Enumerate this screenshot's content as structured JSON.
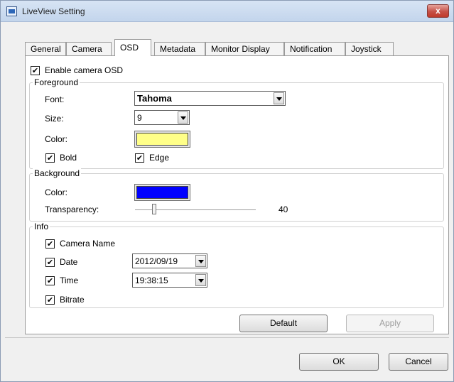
{
  "window": {
    "title": "LiveView Setting",
    "close_label": "x"
  },
  "tabs": [
    {
      "label": "General"
    },
    {
      "label": "Camera"
    },
    {
      "label": "OSD"
    },
    {
      "label": "Metadata"
    },
    {
      "label": "Monitor Display"
    },
    {
      "label": "Notification"
    },
    {
      "label": "Joystick"
    }
  ],
  "active_tab": "OSD",
  "osd": {
    "enable_label": "Enable camera OSD",
    "enable_checked": true,
    "foreground": {
      "title": "Foreground",
      "font_label": "Font:",
      "font_value": "Tahoma",
      "size_label": "Size:",
      "size_value": "9",
      "color_label": "Color:",
      "color_value": "#ffff88",
      "bold_label": "Bold",
      "bold_checked": true,
      "edge_label": "Edge",
      "edge_checked": true
    },
    "background": {
      "title": "Background",
      "color_label": "Color:",
      "color_value": "#0000ff",
      "transparency_label": "Transparency:",
      "transparency_value": "40",
      "transparency_max": 255
    },
    "info": {
      "title": "Info",
      "camera_name_label": "Camera Name",
      "camera_name_checked": true,
      "date_label": "Date",
      "date_checked": true,
      "date_format": "2012/09/19",
      "time_label": "Time",
      "time_checked": true,
      "time_format": "19:38:15",
      "bitrate_label": "Bitrate",
      "bitrate_checked": true
    },
    "default_label": "Default",
    "apply_label": "Apply"
  },
  "footer": {
    "ok_label": "OK",
    "cancel_label": "Cancel"
  },
  "check_glyph": "✔"
}
